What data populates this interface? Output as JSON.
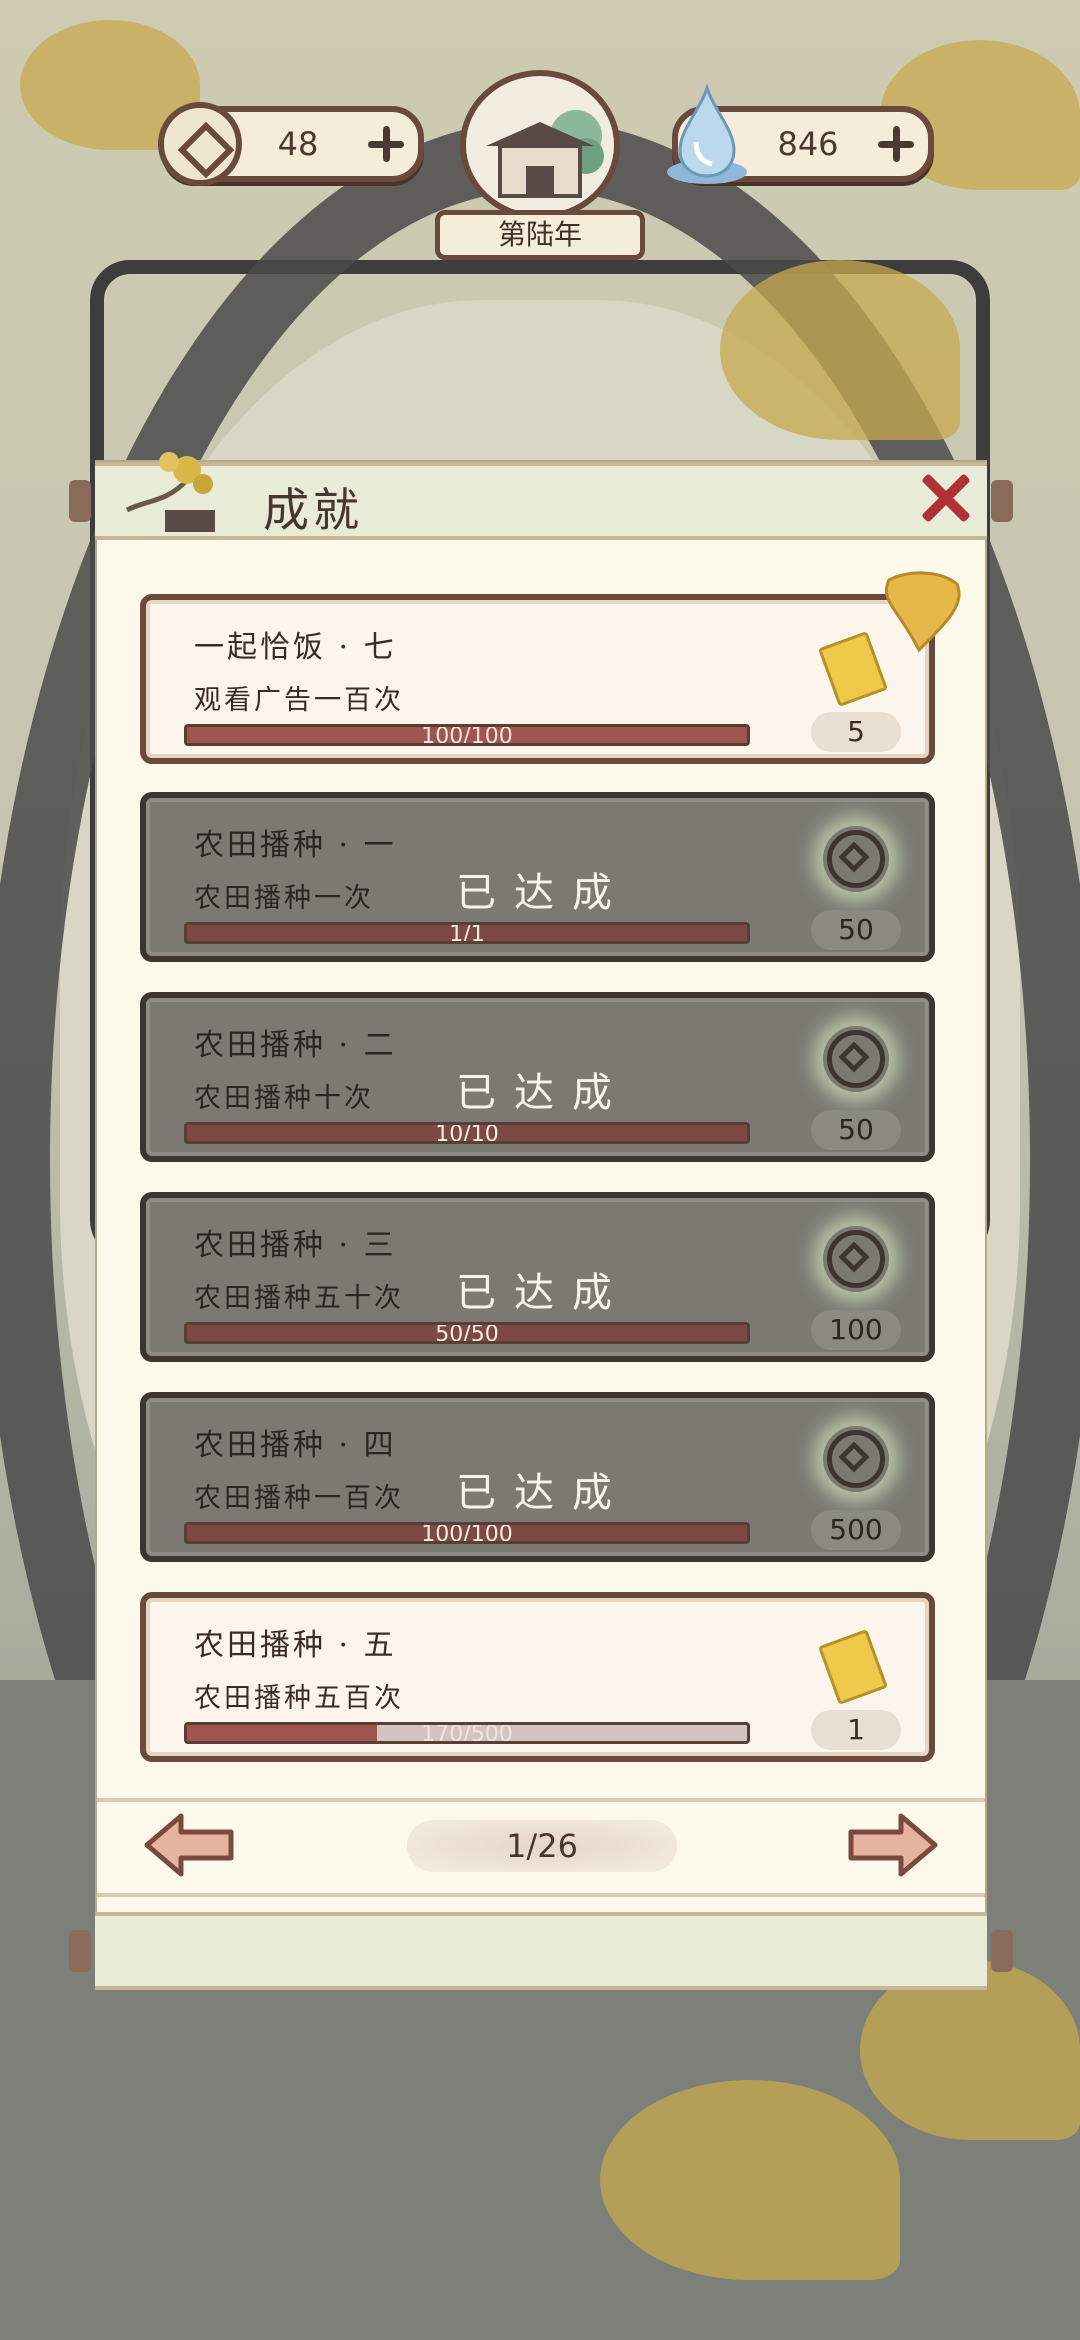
{
  "hud": {
    "coins": "48",
    "spirit": "846",
    "year": "第陆年"
  },
  "panel": {
    "title": "成就"
  },
  "achievements": [
    {
      "name": "一起恰饭 · 七",
      "desc": "观看广告一百次",
      "progress": "100/100",
      "progress_fraction": 1.0,
      "reward": "5",
      "reward_icon": "ticket-icon",
      "completed": false,
      "done_label": ""
    },
    {
      "name": "农田播种 · 一",
      "desc": "农田播种一次",
      "progress": "1/1",
      "progress_fraction": 1.0,
      "reward": "50",
      "reward_icon": "coin-icon",
      "completed": true,
      "done_label": "已达成"
    },
    {
      "name": "农田播种 · 二",
      "desc": "农田播种十次",
      "progress": "10/10",
      "progress_fraction": 1.0,
      "reward": "50",
      "reward_icon": "coin-icon",
      "completed": true,
      "done_label": "已达成"
    },
    {
      "name": "农田播种 · 三",
      "desc": "农田播种五十次",
      "progress": "50/50",
      "progress_fraction": 1.0,
      "reward": "100",
      "reward_icon": "coin-icon",
      "completed": true,
      "done_label": "已达成"
    },
    {
      "name": "农田播种 · 四",
      "desc": "农田播种一百次",
      "progress": "100/100",
      "progress_fraction": 1.0,
      "reward": "500",
      "reward_icon": "coin-icon",
      "completed": true,
      "done_label": "已达成"
    },
    {
      "name": "农田播种 · 五",
      "desc": "农田播种五百次",
      "progress": "170/500",
      "progress_fraction": 0.34,
      "reward": "1",
      "reward_icon": "ticket-icon",
      "completed": false,
      "done_label": ""
    }
  ],
  "pager": {
    "page": "1/26"
  }
}
